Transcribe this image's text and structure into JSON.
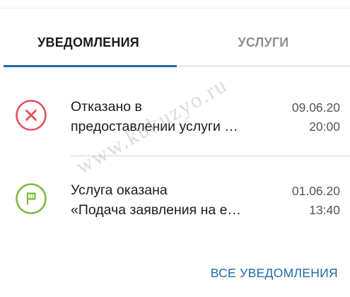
{
  "tabs": {
    "notifications_label": "УВЕДОМЛЕНИЯ",
    "services_label": "УСЛУГИ",
    "active": "notifications"
  },
  "notifications": [
    {
      "status": "rejected",
      "icon": "close-circle-icon",
      "color": "#e3505c",
      "title_line1": "Отказано в",
      "title_line2": "предоставлении услуги …",
      "date": "09.06.20",
      "time": "20:00"
    },
    {
      "status": "provided",
      "icon": "flag-circle-icon",
      "color": "#7cba3d",
      "title_line1": "Услуга оказана",
      "title_line2": "«Подача заявления на е…",
      "date": "01.06.20",
      "time": "13:40"
    }
  ],
  "all_notifications_label": "ВСЕ УВЕДОМЛЕНИЯ",
  "watermark_text": "www.kukuzyo.ru",
  "colors": {
    "accent": "#1f6aa9",
    "error": "#e3505c",
    "success": "#7cba3d"
  }
}
